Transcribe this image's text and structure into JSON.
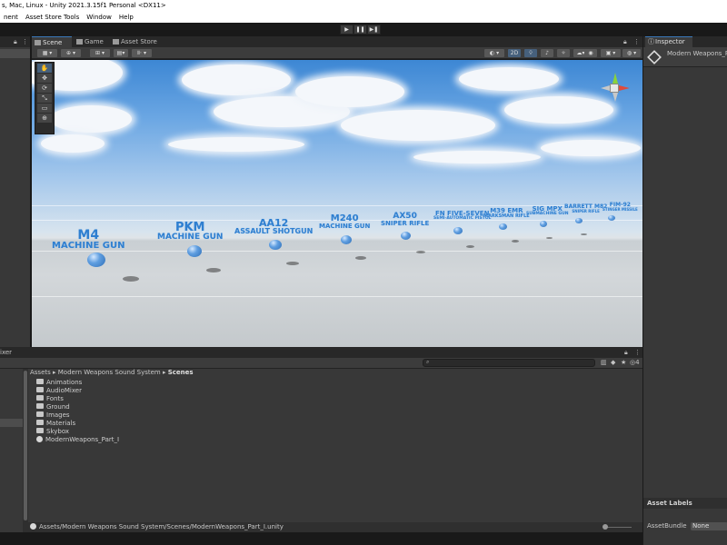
{
  "window": {
    "title": "s, Mac, Linux - Unity 2021.3.15f1 Personal <DX11>"
  },
  "menu": [
    "nent",
    "Asset Store Tools",
    "Window",
    "Help"
  ],
  "play_controls": {
    "play": "▶",
    "pause": "❚❚",
    "step": "▶❚"
  },
  "scene_tabs": [
    {
      "label": "Scene",
      "active": true
    },
    {
      "label": "Game",
      "active": false
    },
    {
      "label": "Asset Store",
      "active": false
    }
  ],
  "scene_toolbar": {
    "mode_2d": "2D"
  },
  "tools": [
    "✋",
    "✥",
    "⟳",
    "⤡",
    "▭",
    "⊕"
  ],
  "weapons": [
    {
      "name": "M4",
      "type": "MACHINE GUN"
    },
    {
      "name": "PKM",
      "type": "MACHINE GUN"
    },
    {
      "name": "AA12",
      "type": "ASSAULT SHOTGUN"
    },
    {
      "name": "M240",
      "type": "MACHINE GUN"
    },
    {
      "name": "AX50",
      "type": "SNIPER RIFLE"
    },
    {
      "name": "FN FIVE-SEVEN",
      "type": "SEMI-AUTOMATIC PISTOL"
    },
    {
      "name": "M39 EMR",
      "type": "MARKSMAN RIFLE"
    },
    {
      "name": "SIG MPX",
      "type": "SUBMACHINE GUN"
    },
    {
      "name": "BARRETT M82",
      "type": "SNIPER RIFLE"
    },
    {
      "name": "FIM-92",
      "type": "STINGER MISSILE"
    }
  ],
  "project": {
    "tab_label": "ixer",
    "badge_count": "4",
    "breadcrumb": [
      "Assets",
      "Modern Weapons Sound System",
      "Scenes"
    ],
    "items": [
      {
        "name": "Animations",
        "kind": "folder"
      },
      {
        "name": "AudioMixer",
        "kind": "folder"
      },
      {
        "name": "Fonts",
        "kind": "folder"
      },
      {
        "name": "Ground",
        "kind": "folder"
      },
      {
        "name": "Images",
        "kind": "folder"
      },
      {
        "name": "Materials",
        "kind": "folder"
      },
      {
        "name": "Skybox",
        "kind": "folder"
      },
      {
        "name": "ModernWeapons_Part_I",
        "kind": "scene"
      }
    ],
    "status_path": "Assets/Modern Weapons Sound System/Scenes/ModernWeapons_Part_I.unity"
  },
  "inspector": {
    "tab_label": "Inspector",
    "title": "Modern Weapons_P",
    "asset_labels": "Asset Labels",
    "assetbundle_label": "AssetBundle",
    "assetbundle_value": "None"
  },
  "colors": {
    "accent": "#3a79bb",
    "weapon_text": "#2f7fd0",
    "panel_bg": "#383838"
  }
}
